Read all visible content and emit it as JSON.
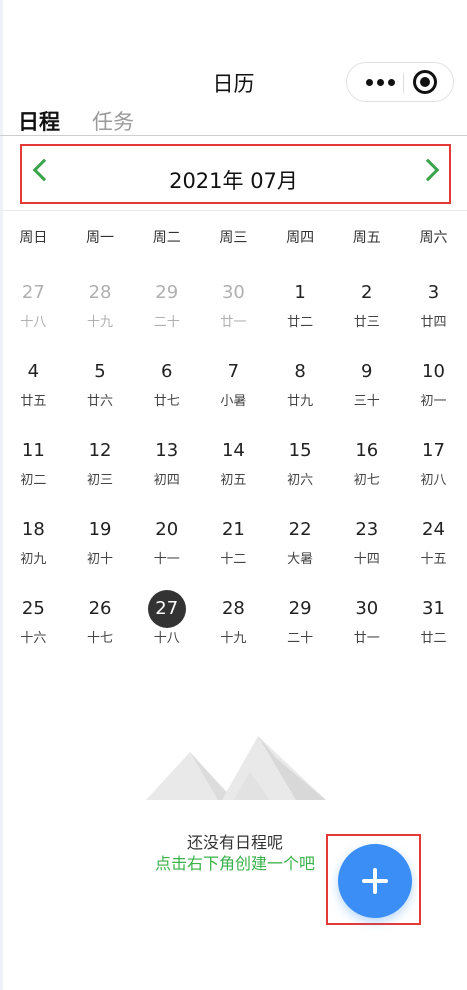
{
  "header": {
    "title": "日历"
  },
  "capsule": {
    "more_icon": "more-dots-icon",
    "close_icon": "target-circle-icon"
  },
  "tabs": [
    {
      "label": "日程",
      "active": true
    },
    {
      "label": "任务",
      "active": false
    }
  ],
  "month_nav": {
    "label": "2021年 07月",
    "prev_icon": "chevron-left-icon",
    "next_icon": "chevron-right-icon",
    "accent_color": "#3aa44a"
  },
  "weekdays": [
    "周日",
    "周一",
    "周二",
    "周三",
    "周四",
    "周五",
    "周六"
  ],
  "weeks": [
    [
      {
        "day": "27",
        "lunar": "十八",
        "muted": true
      },
      {
        "day": "28",
        "lunar": "十九",
        "muted": true
      },
      {
        "day": "29",
        "lunar": "二十",
        "muted": true
      },
      {
        "day": "30",
        "lunar": "廿一",
        "muted": true
      },
      {
        "day": "1",
        "lunar": "廿二"
      },
      {
        "day": "2",
        "lunar": "廿三"
      },
      {
        "day": "3",
        "lunar": "廿四"
      }
    ],
    [
      {
        "day": "4",
        "lunar": "廿五"
      },
      {
        "day": "5",
        "lunar": "廿六"
      },
      {
        "day": "6",
        "lunar": "廿七"
      },
      {
        "day": "7",
        "lunar": "小暑"
      },
      {
        "day": "8",
        "lunar": "廿九"
      },
      {
        "day": "9",
        "lunar": "三十"
      },
      {
        "day": "10",
        "lunar": "初一"
      }
    ],
    [
      {
        "day": "11",
        "lunar": "初二"
      },
      {
        "day": "12",
        "lunar": "初三"
      },
      {
        "day": "13",
        "lunar": "初四"
      },
      {
        "day": "14",
        "lunar": "初五"
      },
      {
        "day": "15",
        "lunar": "初六"
      },
      {
        "day": "16",
        "lunar": "初七"
      },
      {
        "day": "17",
        "lunar": "初八"
      }
    ],
    [
      {
        "day": "18",
        "lunar": "初九"
      },
      {
        "day": "19",
        "lunar": "初十"
      },
      {
        "day": "20",
        "lunar": "十一"
      },
      {
        "day": "21",
        "lunar": "十二"
      },
      {
        "day": "22",
        "lunar": "大暑"
      },
      {
        "day": "23",
        "lunar": "十四"
      },
      {
        "day": "24",
        "lunar": "十五"
      }
    ],
    [
      {
        "day": "25",
        "lunar": "十六"
      },
      {
        "day": "26",
        "lunar": "十七"
      },
      {
        "day": "27",
        "lunar": "十八",
        "today": true
      },
      {
        "day": "28",
        "lunar": "十九"
      },
      {
        "day": "29",
        "lunar": "二十"
      },
      {
        "day": "30",
        "lunar": "廿一"
      },
      {
        "day": "31",
        "lunar": "廿二"
      }
    ]
  ],
  "empty_state": {
    "illustration_icon": "mountains-illustration-icon",
    "line1": "还没有日程呢",
    "line2": "点击右下角创建一个吧"
  },
  "fab": {
    "icon": "plus-icon",
    "color": "#3a8ef6"
  },
  "colors": {
    "highlight_border": "#e53935",
    "today_bg": "#333333",
    "muted_text": "#b0b0b0"
  }
}
